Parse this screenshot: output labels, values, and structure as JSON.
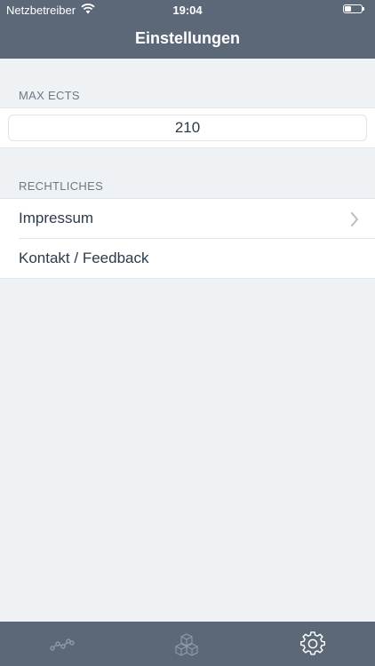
{
  "status_bar": {
    "carrier": "Netzbetreiber",
    "time": "19:04"
  },
  "header": {
    "title": "Einstellungen"
  },
  "sections": {
    "max_ects": {
      "label": "MAX ECTS",
      "value": "210"
    },
    "legal": {
      "label": "RECHTLICHES",
      "items": [
        {
          "label": "Impressum",
          "icon": "chevron-right-icon"
        },
        {
          "label": "Kontakt / Feedback"
        }
      ]
    }
  },
  "tab_bar": {
    "tabs": [
      {
        "icon": "line-chart-icon",
        "active": false
      },
      {
        "icon": "cubes-icon",
        "active": false
      },
      {
        "icon": "gear-icon",
        "active": true
      }
    ]
  },
  "colors": {
    "header_bg": "#5c6878",
    "page_bg": "#eff2f4",
    "text": "#2d3a4a"
  }
}
